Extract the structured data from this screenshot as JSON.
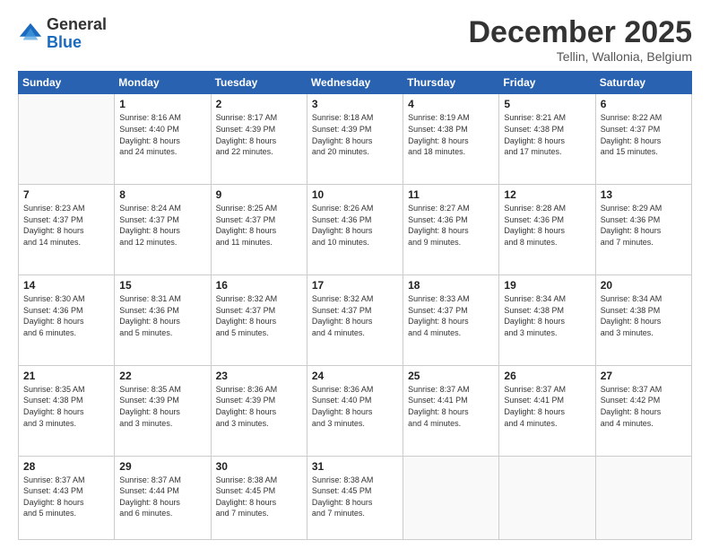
{
  "logo": {
    "general": "General",
    "blue": "Blue"
  },
  "header": {
    "month": "December 2025",
    "location": "Tellin, Wallonia, Belgium"
  },
  "weekdays": [
    "Sunday",
    "Monday",
    "Tuesday",
    "Wednesday",
    "Thursday",
    "Friday",
    "Saturday"
  ],
  "weeks": [
    [
      {
        "day": "",
        "info": ""
      },
      {
        "day": "1",
        "info": "Sunrise: 8:16 AM\nSunset: 4:40 PM\nDaylight: 8 hours\nand 24 minutes."
      },
      {
        "day": "2",
        "info": "Sunrise: 8:17 AM\nSunset: 4:39 PM\nDaylight: 8 hours\nand 22 minutes."
      },
      {
        "day": "3",
        "info": "Sunrise: 8:18 AM\nSunset: 4:39 PM\nDaylight: 8 hours\nand 20 minutes."
      },
      {
        "day": "4",
        "info": "Sunrise: 8:19 AM\nSunset: 4:38 PM\nDaylight: 8 hours\nand 18 minutes."
      },
      {
        "day": "5",
        "info": "Sunrise: 8:21 AM\nSunset: 4:38 PM\nDaylight: 8 hours\nand 17 minutes."
      },
      {
        "day": "6",
        "info": "Sunrise: 8:22 AM\nSunset: 4:37 PM\nDaylight: 8 hours\nand 15 minutes."
      }
    ],
    [
      {
        "day": "7",
        "info": "Sunrise: 8:23 AM\nSunset: 4:37 PM\nDaylight: 8 hours\nand 14 minutes."
      },
      {
        "day": "8",
        "info": "Sunrise: 8:24 AM\nSunset: 4:37 PM\nDaylight: 8 hours\nand 12 minutes."
      },
      {
        "day": "9",
        "info": "Sunrise: 8:25 AM\nSunset: 4:37 PM\nDaylight: 8 hours\nand 11 minutes."
      },
      {
        "day": "10",
        "info": "Sunrise: 8:26 AM\nSunset: 4:36 PM\nDaylight: 8 hours\nand 10 minutes."
      },
      {
        "day": "11",
        "info": "Sunrise: 8:27 AM\nSunset: 4:36 PM\nDaylight: 8 hours\nand 9 minutes."
      },
      {
        "day": "12",
        "info": "Sunrise: 8:28 AM\nSunset: 4:36 PM\nDaylight: 8 hours\nand 8 minutes."
      },
      {
        "day": "13",
        "info": "Sunrise: 8:29 AM\nSunset: 4:36 PM\nDaylight: 8 hours\nand 7 minutes."
      }
    ],
    [
      {
        "day": "14",
        "info": "Sunrise: 8:30 AM\nSunset: 4:36 PM\nDaylight: 8 hours\nand 6 minutes."
      },
      {
        "day": "15",
        "info": "Sunrise: 8:31 AM\nSunset: 4:36 PM\nDaylight: 8 hours\nand 5 minutes."
      },
      {
        "day": "16",
        "info": "Sunrise: 8:32 AM\nSunset: 4:37 PM\nDaylight: 8 hours\nand 5 minutes."
      },
      {
        "day": "17",
        "info": "Sunrise: 8:32 AM\nSunset: 4:37 PM\nDaylight: 8 hours\nand 4 minutes."
      },
      {
        "day": "18",
        "info": "Sunrise: 8:33 AM\nSunset: 4:37 PM\nDaylight: 8 hours\nand 4 minutes."
      },
      {
        "day": "19",
        "info": "Sunrise: 8:34 AM\nSunset: 4:38 PM\nDaylight: 8 hours\nand 3 minutes."
      },
      {
        "day": "20",
        "info": "Sunrise: 8:34 AM\nSunset: 4:38 PM\nDaylight: 8 hours\nand 3 minutes."
      }
    ],
    [
      {
        "day": "21",
        "info": "Sunrise: 8:35 AM\nSunset: 4:38 PM\nDaylight: 8 hours\nand 3 minutes."
      },
      {
        "day": "22",
        "info": "Sunrise: 8:35 AM\nSunset: 4:39 PM\nDaylight: 8 hours\nand 3 minutes."
      },
      {
        "day": "23",
        "info": "Sunrise: 8:36 AM\nSunset: 4:39 PM\nDaylight: 8 hours\nand 3 minutes."
      },
      {
        "day": "24",
        "info": "Sunrise: 8:36 AM\nSunset: 4:40 PM\nDaylight: 8 hours\nand 3 minutes."
      },
      {
        "day": "25",
        "info": "Sunrise: 8:37 AM\nSunset: 4:41 PM\nDaylight: 8 hours\nand 4 minutes."
      },
      {
        "day": "26",
        "info": "Sunrise: 8:37 AM\nSunset: 4:41 PM\nDaylight: 8 hours\nand 4 minutes."
      },
      {
        "day": "27",
        "info": "Sunrise: 8:37 AM\nSunset: 4:42 PM\nDaylight: 8 hours\nand 4 minutes."
      }
    ],
    [
      {
        "day": "28",
        "info": "Sunrise: 8:37 AM\nSunset: 4:43 PM\nDaylight: 8 hours\nand 5 minutes."
      },
      {
        "day": "29",
        "info": "Sunrise: 8:37 AM\nSunset: 4:44 PM\nDaylight: 8 hours\nand 6 minutes."
      },
      {
        "day": "30",
        "info": "Sunrise: 8:38 AM\nSunset: 4:45 PM\nDaylight: 8 hours\nand 7 minutes."
      },
      {
        "day": "31",
        "info": "Sunrise: 8:38 AM\nSunset: 4:45 PM\nDaylight: 8 hours\nand 7 minutes."
      },
      {
        "day": "",
        "info": ""
      },
      {
        "day": "",
        "info": ""
      },
      {
        "day": "",
        "info": ""
      }
    ]
  ]
}
